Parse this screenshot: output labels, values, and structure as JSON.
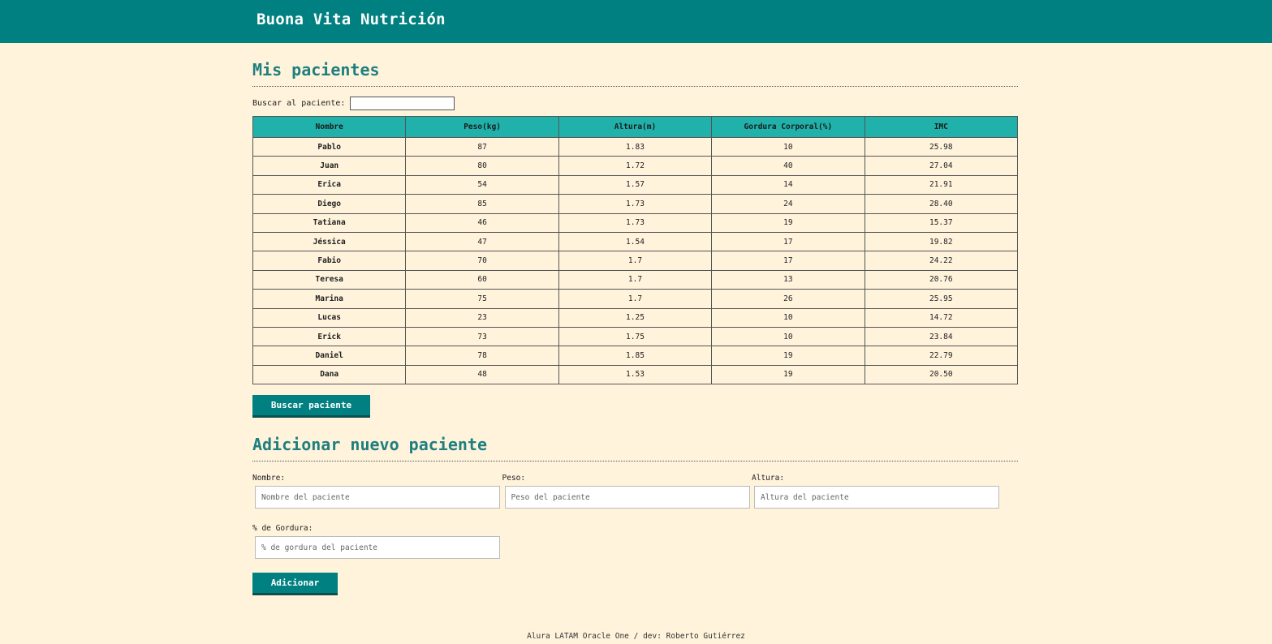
{
  "header": {
    "brand": "Buona Vita Nutrición"
  },
  "patients_section": {
    "title": "Mis pacientes",
    "search_label": "Buscar al paciente:",
    "search_value": "",
    "columns": [
      "Nombre",
      "Peso(kg)",
      "Altura(m)",
      "Gordura Corporal(%)",
      "IMC"
    ],
    "rows": [
      [
        "Pablo",
        "87",
        "1.83",
        "10",
        "25.98"
      ],
      [
        "Juan",
        "80",
        "1.72",
        "40",
        "27.04"
      ],
      [
        "Erica",
        "54",
        "1.57",
        "14",
        "21.91"
      ],
      [
        "Diego",
        "85",
        "1.73",
        "24",
        "28.40"
      ],
      [
        "Tatiana",
        "46",
        "1.73",
        "19",
        "15.37"
      ],
      [
        "Jéssica",
        "47",
        "1.54",
        "17",
        "19.82"
      ],
      [
        "Fabio",
        "70",
        "1.7",
        "17",
        "24.22"
      ],
      [
        "Teresa",
        "60",
        "1.7",
        "13",
        "20.76"
      ],
      [
        "Marina",
        "75",
        "1.7",
        "26",
        "25.95"
      ],
      [
        "Lucas",
        "23",
        "1.25",
        "10",
        "14.72"
      ],
      [
        "Erick",
        "73",
        "1.75",
        "10",
        "23.84"
      ],
      [
        "Daniel",
        "78",
        "1.85",
        "19",
        "22.79"
      ],
      [
        "Dana",
        "48",
        "1.53",
        "19",
        "20.50"
      ]
    ],
    "search_button": "Buscar paciente"
  },
  "add_section": {
    "title": "Adicionar nuevo paciente",
    "fields": {
      "nombre": {
        "label": "Nombre:",
        "placeholder": "Nombre del paciente"
      },
      "peso": {
        "label": "Peso:",
        "placeholder": "Peso del paciente"
      },
      "altura": {
        "label": "Altura:",
        "placeholder": "Altura del paciente"
      },
      "gordura": {
        "label": "% de Gordura:",
        "placeholder": "% de gordura del paciente"
      }
    },
    "submit_button": "Adicionar"
  },
  "footer": {
    "text": "Alura LATAM Oracle One / dev: Roberto Gutiérrez"
  },
  "colors": {
    "header_bg": "#008080",
    "page_bg": "#fff3dc",
    "table_header_bg": "#20b2aa",
    "title_color": "#1e7f7f"
  }
}
